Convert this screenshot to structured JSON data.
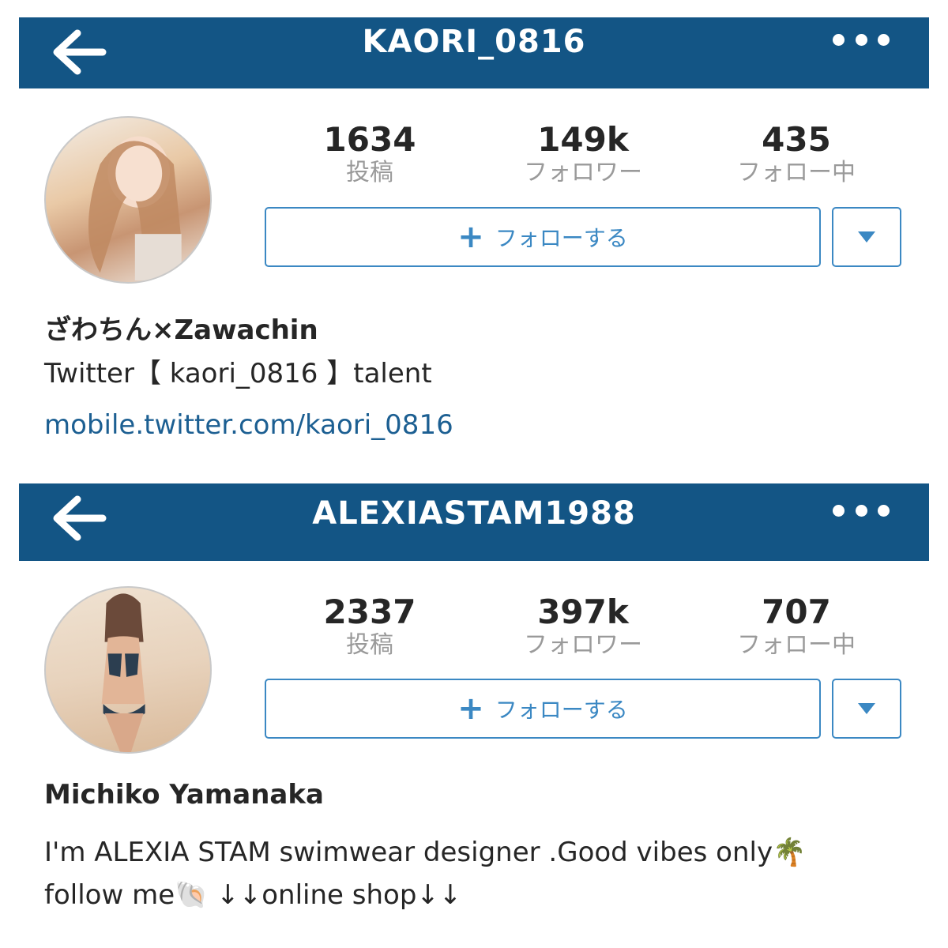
{
  "profiles": [
    {
      "username": "KAORI_0816",
      "stats": [
        {
          "value": "1634",
          "label": "投稿"
        },
        {
          "value": "149k",
          "label": "フォロワー"
        },
        {
          "value": "435",
          "label": "フォロー中"
        }
      ],
      "follow_label": "フォローする",
      "full_name": "ざわちん×Zawachin",
      "bio": "Twitter【 kaori_0816 】talent",
      "link": "mobile.twitter.com/kaori_0816"
    },
    {
      "username": "ALEXIASTAM1988",
      "stats": [
        {
          "value": "2337",
          "label": "投稿"
        },
        {
          "value": "397k",
          "label": "フォロワー"
        },
        {
          "value": "707",
          "label": "フォロー中"
        }
      ],
      "follow_label": "フォローする",
      "full_name": "Michiko Yamanaka",
      "bio_line1": "I'm ALEXIA STAM swimwear designer .Good vibes only🌴",
      "bio_line2": "follow me🐚 ↓↓online shop↓↓"
    }
  ],
  "colors": {
    "header_bg": "#135585",
    "button_blue": "#3b88c3",
    "link_blue": "#1c5f92",
    "label_gray": "#9a9a9a"
  },
  "icons": {
    "back": "arrow-left-icon",
    "more": "more-dots-icon",
    "plus": "plus-icon",
    "dropdown": "triangle-down-icon"
  }
}
